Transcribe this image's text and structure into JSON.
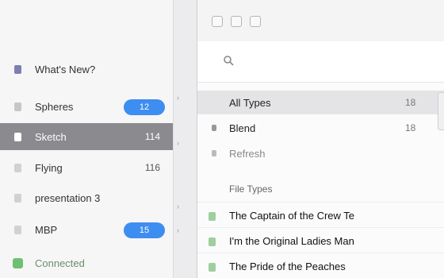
{
  "sidebar": {
    "whats_new": "What's New?",
    "items": [
      {
        "label": "Spheres",
        "count": "12",
        "pill": true
      },
      {
        "label": "Sketch",
        "count": "114",
        "selected": true
      },
      {
        "label": "Flying",
        "count": "116"
      },
      {
        "label": "presentation 3",
        "count": ""
      },
      {
        "label": "MBP",
        "count": "15",
        "pill": true
      }
    ],
    "connected": "Connected"
  },
  "main": {
    "filters": [
      {
        "label": "All Types",
        "count": "18",
        "active": true
      },
      {
        "label": "Blend",
        "count": "18"
      },
      {
        "label": "Refresh",
        "count": ""
      }
    ],
    "section_title": "File Types",
    "rows": [
      {
        "label": "The Captain of the Crew Te"
      },
      {
        "label": "I'm the Original Ladies Man"
      },
      {
        "label": "The Pride of the Peaches"
      }
    ]
  },
  "colors": {
    "accent": "#3e8df0",
    "selected_row": "#8a8a8f",
    "connected_green": "#4caf50"
  }
}
